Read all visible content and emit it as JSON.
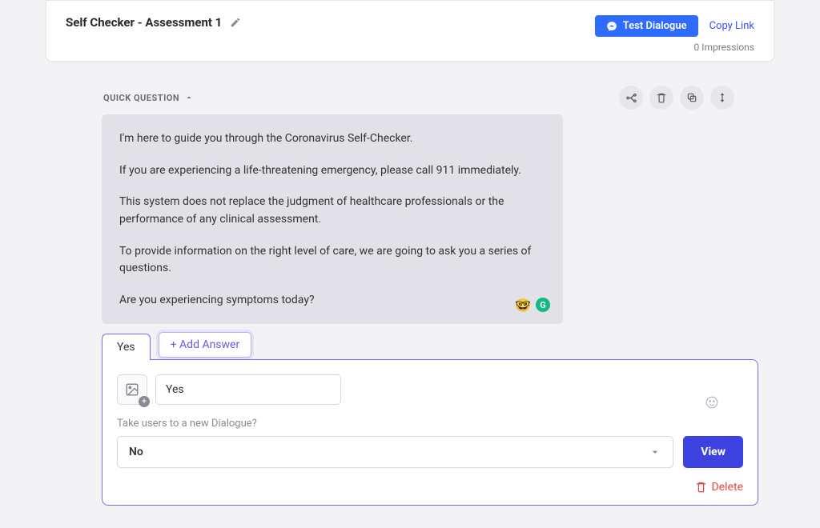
{
  "header": {
    "title": "Self Checker - Assessment 1",
    "test_label": "Test Dialogue",
    "copy_link_label": "Copy Link",
    "impressions": "0 Impressions"
  },
  "section": {
    "label": "QUICK QUESTION"
  },
  "question": {
    "p1": "I'm here to guide you through the Coronavirus Self-Checker.",
    "p2": "If you are experiencing a life-threatening emergency, please call 911 immediately.",
    "p3": "This system does not replace the judgment of healthcare professionals or the performance of any clinical assessment.",
    "p4": "To provide information on the right level of care, we are going to ask you a series of questions.",
    "p5": "Are you experiencing symptoms today?"
  },
  "badges": {
    "emoji": "🤓",
    "g": "G"
  },
  "answers": {
    "tab1_label": "Yes",
    "add_label": "+ Add Answer",
    "input_value": "Yes",
    "prompt": "Take users to a new Dialogue?",
    "select_value": "No",
    "view_label": "View",
    "delete_label": "Delete"
  }
}
